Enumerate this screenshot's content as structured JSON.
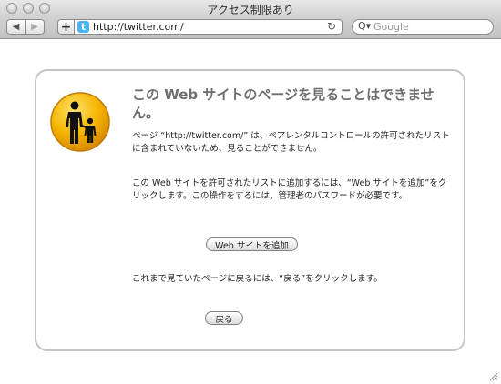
{
  "window": {
    "title": "アクセス制限あり"
  },
  "toolbar": {
    "back_icon": "◀",
    "forward_icon": "▶",
    "add_icon": "+",
    "url": "http://twitter.com/",
    "favicon_letter": "t",
    "reload_icon": "↻",
    "search_placeholder": "Google",
    "search_icon": "Q▾"
  },
  "page": {
    "heading": "この Web サイトのページを見ることはできません。",
    "message": "ページ “http://twitter.com/” は、ペアレンタルコントロールの許可されたリストに含まれていないため、見ることができません。",
    "instruction": "この Web サイトを許可されたリストに追加するには、“Web サイトを追加”をクリックします。この操作をするには、管理者のパスワードが必要です。",
    "add_button": "Web サイトを追加",
    "back_instruction": "これまで見ていたページに戻るには、“戻る”をクリックします。",
    "back_button": "戻る"
  }
}
